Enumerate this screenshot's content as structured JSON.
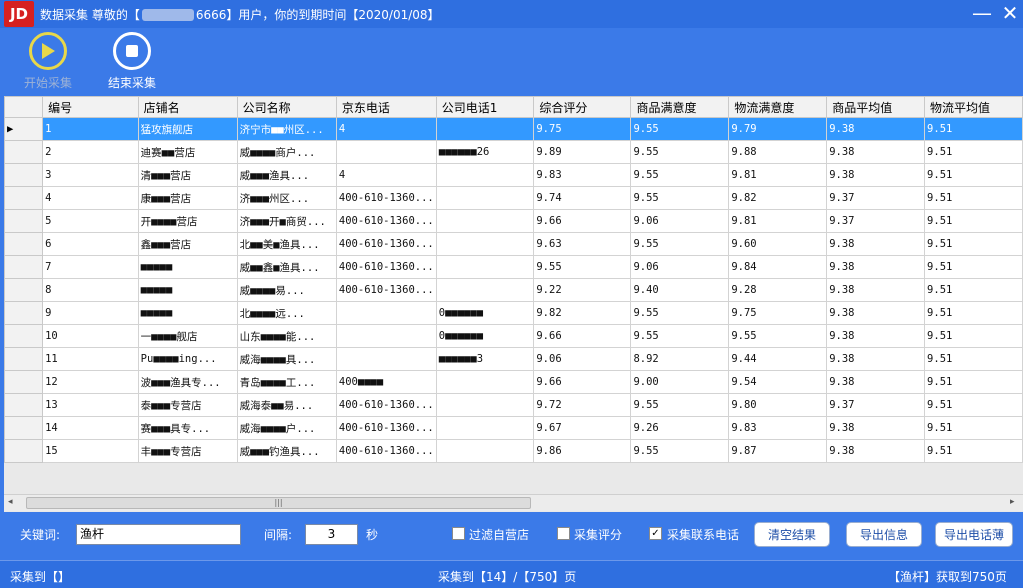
{
  "window": {
    "logo": "JD",
    "title_prefix": "数据采集 尊敬的【",
    "title_suffix": "6666】用户，你的到期时间【2020/01/08】",
    "minimize": "—",
    "close": "✕"
  },
  "toolbar": {
    "start_label": "开始采集",
    "stop_label": "结束采集"
  },
  "table": {
    "columns": [
      "",
      "编号",
      "店铺名",
      "公司名称",
      "京东电话",
      "公司电话1",
      "综合评分",
      "商品满意度",
      "物流满意度",
      "商品平均值",
      "物流平均值"
    ],
    "rows": [
      [
        "1",
        "猛攻旗舰店",
        "济宁市■■州区...",
        "4",
        "",
        "9.75",
        "9.55",
        "9.79",
        "9.38",
        "9.51"
      ],
      [
        "2",
        "迪赛■■营店",
        "威■■■■商户...",
        "",
        "■■■■■■26",
        "9.89",
        "9.55",
        "9.88",
        "9.38",
        "9.51"
      ],
      [
        "3",
        "清■■■营店",
        "威■■■渔具...",
        "4",
        "",
        "9.83",
        "9.55",
        "9.81",
        "9.38",
        "9.51"
      ],
      [
        "4",
        "康■■■营店",
        "济■■■州区...",
        "400-610-1360...",
        "",
        "9.74",
        "9.55",
        "9.82",
        "9.37",
        "9.51"
      ],
      [
        "5",
        "开■■■■营店",
        "济■■■开■商贸...",
        "400-610-1360...",
        "",
        "9.66",
        "9.06",
        "9.81",
        "9.37",
        "9.51"
      ],
      [
        "6",
        "鑫■■■营店",
        "北■■美■渔具...",
        "400-610-1360...",
        "",
        "9.63",
        "9.55",
        "9.60",
        "9.38",
        "9.51"
      ],
      [
        "7",
        "■■■■■",
        "威■■鑫■渔具...",
        "400-610-1360...",
        "",
        "9.55",
        "9.06",
        "9.84",
        "9.38",
        "9.51"
      ],
      [
        "8",
        "■■■■■",
        "威■■■■易...",
        "400-610-1360...",
        "",
        "9.22",
        "9.40",
        "9.28",
        "9.38",
        "9.51"
      ],
      [
        "9",
        "■■■■■",
        "北■■■■远...",
        "",
        "0■■■■■■",
        "9.82",
        "9.55",
        "9.75",
        "9.38",
        "9.51"
      ],
      [
        "10",
        "一■■■■舰店",
        "山东■■■■能...",
        "",
        "0■■■■■■",
        "9.66",
        "9.55",
        "9.55",
        "9.38",
        "9.51"
      ],
      [
        "11",
        "Pu■■■■ing...",
        "威海■■■■具...",
        "",
        "■■■■■■3",
        "9.06",
        "8.92",
        "9.44",
        "9.38",
        "9.51"
      ],
      [
        "12",
        "波■■■渔具专...",
        "青岛■■■■工...",
        "400■■■■",
        "",
        "9.66",
        "9.00",
        "9.54",
        "9.38",
        "9.51"
      ],
      [
        "13",
        "泰■■■专营店",
        "威海泰■■易...",
        "400-610-1360...",
        "",
        "9.72",
        "9.55",
        "9.80",
        "9.37",
        "9.51"
      ],
      [
        "14",
        "赛■■■具专...",
        "威海■■■■户...",
        "400-610-1360...",
        "",
        "9.67",
        "9.26",
        "9.83",
        "9.38",
        "9.51"
      ],
      [
        "15",
        "丰■■■专营店",
        "威■■■钓渔具...",
        "400-610-1360...",
        "",
        "9.86",
        "9.55",
        "9.87",
        "9.38",
        "9.51"
      ]
    ]
  },
  "scrollbar": {
    "left": "◂",
    "right": "▸",
    "grip": "|||"
  },
  "controls": {
    "keyword_label": "关键词:",
    "keyword_value": "渔杆",
    "interval_label": "间隔:",
    "interval_value": "3",
    "interval_unit": "秒",
    "filter_self_label": "过滤自营店",
    "filter_self_checked": "",
    "collect_score_label": "采集评分",
    "collect_score_checked": "",
    "collect_phone_label": "采集联系电话",
    "collect_phone_checked": "✓",
    "clear_button": "清空结果",
    "export_info_button": "导出信息",
    "export_phone_button": "导出电话薄"
  },
  "status": {
    "left": "采集到【】",
    "center": "采集到【14】/【750】页",
    "right": "【渔杆】获取到750页"
  }
}
